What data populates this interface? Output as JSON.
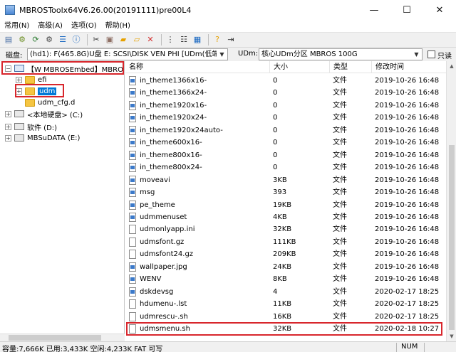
{
  "window": {
    "title": "MBROSToolx64V6.26.00(20191111)pre00L4",
    "min_glyph": "—",
    "max_glyph": "☐",
    "close_glyph": "✕"
  },
  "menu": {
    "items": [
      "常用(N)",
      "高级(A)",
      "选项(O)",
      "帮助(H)"
    ]
  },
  "toolbar": {
    "buttons": [
      {
        "icon": "open-icon",
        "glyph": "▤",
        "color": "#4a6fa5"
      },
      {
        "icon": "gear-icon",
        "glyph": "⚙",
        "color": "#6b8e23"
      },
      {
        "icon": "refresh-icon",
        "glyph": "⟳",
        "color": "#2e7d32"
      },
      {
        "icon": "settings-icon",
        "glyph": "⚙",
        "color": "#444444"
      },
      {
        "icon": "list-icon",
        "glyph": "☰",
        "color": "#1565c0"
      },
      {
        "icon": "info-icon",
        "glyph": "ⓘ",
        "color": "#1565c0"
      },
      {
        "icon": "cut-icon",
        "glyph": "✂",
        "color": "#333333"
      },
      {
        "icon": "paste-icon",
        "glyph": "▣",
        "color": "#8d6e63"
      },
      {
        "icon": "new-folder-icon",
        "glyph": "▰",
        "color": "#e6a100"
      },
      {
        "icon": "folder-icon",
        "glyph": "▱",
        "color": "#e6a100"
      },
      {
        "icon": "delete-icon",
        "glyph": "✕",
        "color": "#d32f2f"
      },
      {
        "icon": "properties-icon",
        "glyph": "⋮",
        "color": "#333333"
      },
      {
        "icon": "details-icon",
        "glyph": "☷",
        "color": "#333333"
      },
      {
        "icon": "grid-icon",
        "glyph": "▦",
        "color": "#1565c0"
      },
      {
        "icon": "help-icon",
        "glyph": "?",
        "color": "#e6a100"
      },
      {
        "icon": "exit-icon",
        "glyph": "⇥",
        "color": "#333333"
      }
    ]
  },
  "diskbar": {
    "disk_label": "磁盘:",
    "disk_value": "(hd1): F(465.8G)U盘  E: SCSI\\DISK  VEN PHI [UDm(低端",
    "udm_label": "UDm:",
    "udm_value": "核心UDm分区  MBROS 100G",
    "ghost_label": "只读"
  },
  "tree": {
    "items": [
      {
        "label": "【W MBROSEmbed】MBRO",
        "expander": "⊟",
        "icon": "usb",
        "level": 0
      },
      {
        "label": "efi",
        "expander": "⊞",
        "icon": "folder",
        "level": 1
      },
      {
        "label": "udm",
        "expander": "⊞",
        "icon": "folder",
        "level": 1,
        "selected": true
      },
      {
        "label": "udm_cfg.d",
        "expander": "",
        "icon": "folder",
        "level": 1
      },
      {
        "label": "<本地硬盘> (C:)",
        "expander": "⊞",
        "icon": "drive",
        "level": 0
      },
      {
        "label": "软件 (D:)",
        "expander": "⊞",
        "icon": "drive",
        "level": 0
      },
      {
        "label": "MBSuDATA (E:)",
        "expander": "⊞",
        "icon": "drive",
        "level": 0
      }
    ]
  },
  "list": {
    "columns": [
      "名称",
      "大小",
      "类型",
      "修改时间"
    ],
    "rows": [
      {
        "name": "in_theme1366x16-",
        "size": "0",
        "type": "文件",
        "date": "2019-10-26 16:48",
        "icon": "blue"
      },
      {
        "name": "in_theme1366x24-",
        "size": "0",
        "type": "文件",
        "date": "2019-10-26 16:48",
        "icon": "blue"
      },
      {
        "name": "in_theme1920x16-",
        "size": "0",
        "type": "文件",
        "date": "2019-10-26 16:48",
        "icon": "blue"
      },
      {
        "name": "in_theme1920x24-",
        "size": "0",
        "type": "文件",
        "date": "2019-10-26 16:48",
        "icon": "blue"
      },
      {
        "name": "in_theme1920x24auto-",
        "size": "0",
        "type": "文件",
        "date": "2019-10-26 16:48",
        "icon": "blue"
      },
      {
        "name": "in_theme600x16-",
        "size": "0",
        "type": "文件",
        "date": "2019-10-26 16:48",
        "icon": "blue"
      },
      {
        "name": "in_theme800x16-",
        "size": "0",
        "type": "文件",
        "date": "2019-10-26 16:48",
        "icon": "blue"
      },
      {
        "name": "in_theme800x24-",
        "size": "0",
        "type": "文件",
        "date": "2019-10-26 16:48",
        "icon": "blue"
      },
      {
        "name": "moveavi",
        "size": "3KB",
        "type": "文件",
        "date": "2019-10-26 16:48",
        "icon": "blue"
      },
      {
        "name": "msg",
        "size": "393",
        "type": "文件",
        "date": "2019-10-26 16:48",
        "icon": "blue"
      },
      {
        "name": "pe_theme",
        "size": "19KB",
        "type": "文件",
        "date": "2019-10-26 16:48",
        "icon": "blue"
      },
      {
        "name": "udmmenuset",
        "size": "4KB",
        "type": "文件",
        "date": "2019-10-26 16:48",
        "icon": "blue"
      },
      {
        "name": "udmonlyapp.ini",
        "size": "32KB",
        "type": "文件",
        "date": "2019-10-26 16:48",
        "icon": "plain"
      },
      {
        "name": "udmsfont.gz",
        "size": "111KB",
        "type": "文件",
        "date": "2019-10-26 16:48",
        "icon": "plain"
      },
      {
        "name": "udmsfont24.gz",
        "size": "209KB",
        "type": "文件",
        "date": "2019-10-26 16:48",
        "icon": "plain"
      },
      {
        "name": "wallpaper.jpg",
        "size": "24KB",
        "type": "文件",
        "date": "2019-10-26 16:48",
        "icon": "blue"
      },
      {
        "name": "WENV",
        "size": "8KB",
        "type": "文件",
        "date": "2019-10-26 16:48",
        "icon": "blue"
      },
      {
        "name": "dskdevsg",
        "size": "4",
        "type": "文件",
        "date": "2020-02-17 18:25",
        "icon": "blue"
      },
      {
        "name": "hdumenu-.lst",
        "size": "11KB",
        "type": "文件",
        "date": "2020-02-17 18:25",
        "icon": "plain"
      },
      {
        "name": "udmrescu-.sh",
        "size": "16KB",
        "type": "文件",
        "date": "2020-02-17 18:25",
        "icon": "plain"
      },
      {
        "name": "udmsmenu.sh",
        "size": "32KB",
        "type": "文件",
        "date": "2020-02-18 10:27",
        "icon": "plain",
        "highlight": true
      }
    ]
  },
  "status": {
    "text": "容量:7,666K 已用:3,433K 空闲:4,233K FAT 可写",
    "num": "NUM"
  },
  "colors": {
    "highlight_border": "#d8262c",
    "selection": "#0078d7"
  }
}
